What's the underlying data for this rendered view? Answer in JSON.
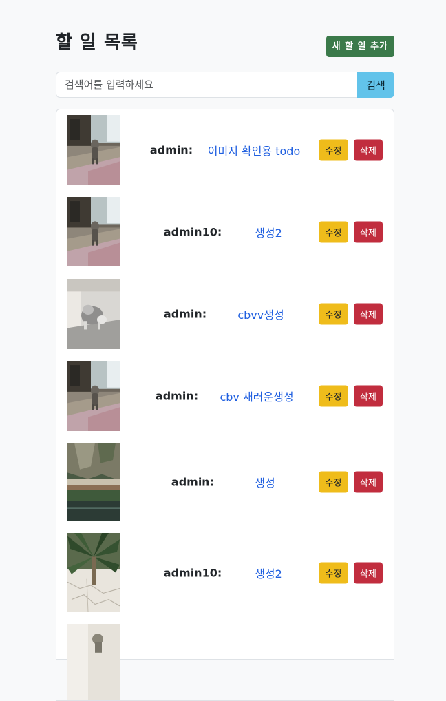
{
  "page": {
    "title": "할 일 목록",
    "add_button_label": "새 할 일 추가"
  },
  "search": {
    "placeholder": "검색어를 입력하세요",
    "button_label": "검색"
  },
  "todos": [
    {
      "author": "admin:",
      "title": "이미지 확인용 todo",
      "edit_label": "수정",
      "delete_label": "삭제",
      "image": "dog-standing-living-room"
    },
    {
      "author": "admin10:",
      "title": "생성2",
      "edit_label": "수정",
      "delete_label": "삭제",
      "image": "dog-standing-living-room"
    },
    {
      "author": "admin:",
      "title": "cbvv생성",
      "edit_label": "수정",
      "delete_label": "삭제",
      "image": "dog-playing-on-floor"
    },
    {
      "author": "admin:",
      "title": "cbv 새러운생성",
      "edit_label": "수정",
      "delete_label": "삭제",
      "image": "dog-standing-living-room"
    },
    {
      "author": "admin:",
      "title": "생성",
      "edit_label": "수정",
      "delete_label": "삭제",
      "image": "cliff-resort-pool"
    },
    {
      "author": "admin10:",
      "title": "생성2",
      "edit_label": "수정",
      "delete_label": "삭제",
      "image": "palm-tree-stone-wall"
    },
    {
      "author": "",
      "title": "",
      "edit_label": "",
      "delete_label": "",
      "image": "dog-indoor-partial"
    }
  ],
  "colors": {
    "add_button": "#3b7a4a",
    "search_button": "#62c3ea",
    "edit_button": "#efbc1b",
    "delete_button": "#c12d3e",
    "title_link": "#1f5fe0"
  }
}
